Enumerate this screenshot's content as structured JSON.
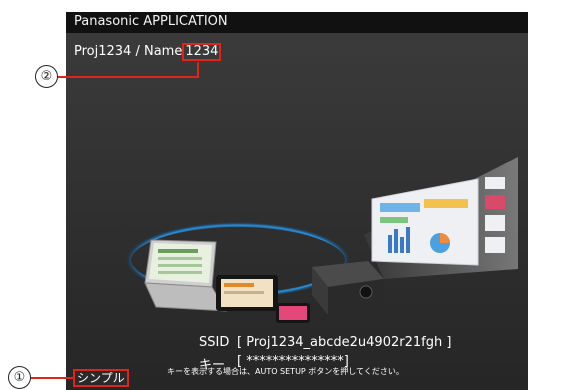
{
  "titlebar": {
    "title": "Panasonic APPLICATION"
  },
  "project": {
    "prefix": "Proj1234 / Name",
    "name_suffix": "1234"
  },
  "connection": {
    "ssid_label": "SSID",
    "ssid_value": "[ Proj1234_abcde2u4902r21fgh ]",
    "key_label": "キー",
    "key_value": "[ ***************]",
    "note": "キーを表示する場合は、AUTO SETUP ボタンを押してください。"
  },
  "mode": {
    "label": "シンプル"
  },
  "callouts": {
    "one": "①",
    "two": "②"
  },
  "colors": {
    "highlight": "#e2231a",
    "titlebar": "#111111",
    "background": "#333333"
  }
}
